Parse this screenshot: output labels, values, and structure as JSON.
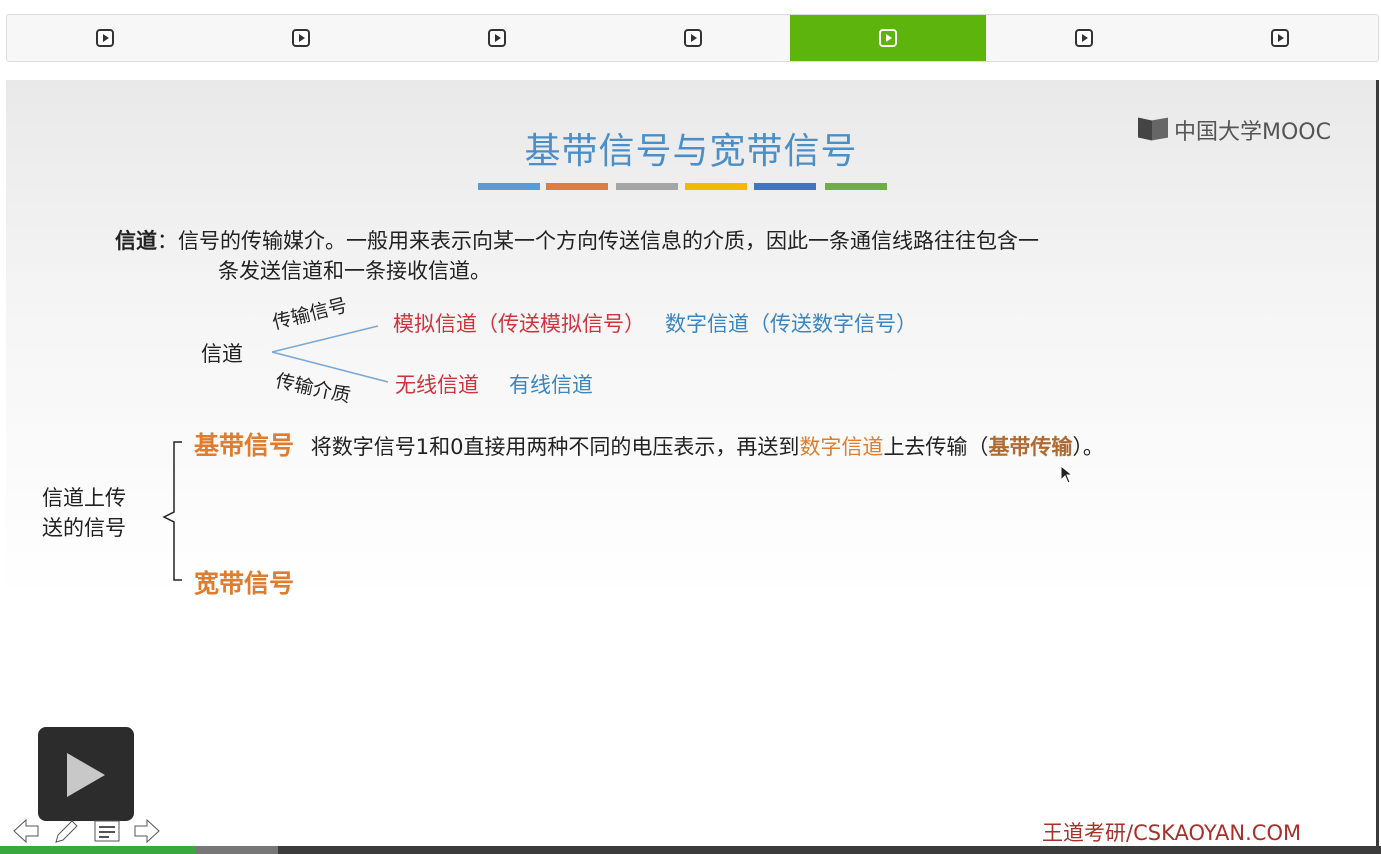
{
  "tabs": [
    {
      "icon": "play-icon",
      "active": false
    },
    {
      "icon": "play-icon",
      "active": false
    },
    {
      "icon": "play-icon",
      "active": false
    },
    {
      "icon": "play-icon",
      "active": false
    },
    {
      "icon": "play-icon",
      "active": true
    },
    {
      "icon": "play-icon",
      "active": false
    },
    {
      "icon": "play-icon",
      "active": false
    }
  ],
  "colors": {
    "active_tab": "#5cb40c",
    "title": "#4a8fc8",
    "red": "#d0333c",
    "blue": "#3b86c0",
    "orange": "#e07c2d",
    "footer": "#a8302a",
    "title_underline": [
      "#5b9bd5",
      "#e07c3d",
      "#a5a5a5",
      "#f5b800",
      "#4472c4",
      "#70ad47"
    ]
  },
  "slide": {
    "title": "基带信号与宽带信号",
    "logo": "中国大学MOOC",
    "definition": {
      "term": "信道",
      "colon": "：",
      "line1": "信号的传输媒介。一般用来表示向某一个方向传送信息的介质，因此一条通信线路往往包含一",
      "line2": "条发送信道和一条接收信道。"
    },
    "tree": {
      "root": "信道",
      "branch_top": "传输信号",
      "branch_bottom": "传输介质",
      "top_analog": "模拟信道（传送模拟信号）",
      "top_digital": "数字信道（传送数字信号）",
      "bottom_wireless": "无线信道",
      "bottom_wired": "有线信道"
    },
    "signals": {
      "group_line1": "信道上传",
      "group_line2": "送的信号",
      "baseband_label": "基带信号",
      "baseband_desc_1": "将数字信号1和0直接用两种不同的电压表示，再送到",
      "baseband_desc_digital": "数字信道",
      "baseband_desc_2": "上去传输（",
      "baseband_desc_term": "基带传输",
      "baseband_desc_3": "）。",
      "broadband_label": "宽带信号"
    },
    "footer": "王道考研/CSKAOYAN.COM"
  },
  "player": {
    "controls": [
      "arrow-left-icon",
      "pen-icon",
      "notes-icon",
      "arrow-right-icon"
    ],
    "played_fraction": 0.142,
    "buffered_fraction": 0.201
  }
}
